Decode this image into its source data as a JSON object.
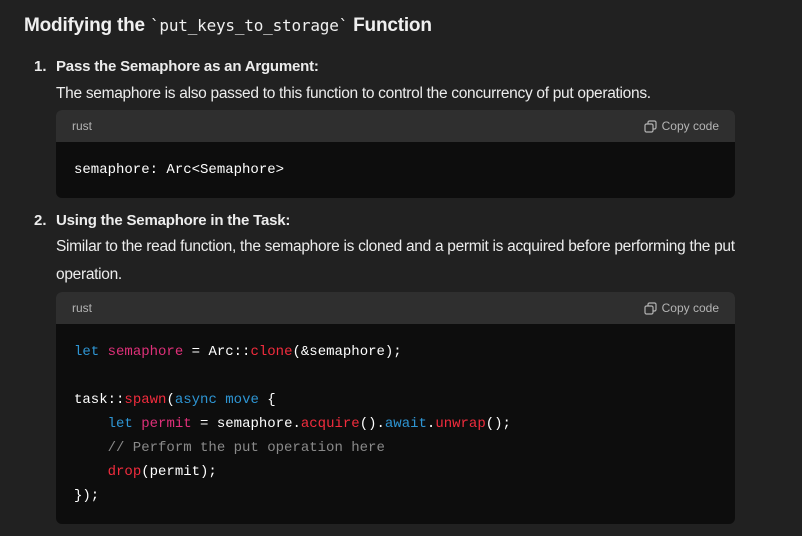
{
  "heading": {
    "pre": "Modifying the ",
    "code": "`put_keys_to_storage`",
    "post": " Function"
  },
  "items": [
    {
      "number": "1.",
      "title": "Pass the Semaphore as an Argument:",
      "text": "The semaphore is also passed to this function to control the concurrency of put operations.",
      "code": {
        "language": "rust",
        "copy_label": "Copy code",
        "lines": [
          [
            [
              "",
              "semaphore: Arc<Semaphore>"
            ]
          ]
        ]
      }
    },
    {
      "number": "2.",
      "title": "Using the Semaphore in the Task:",
      "text": "Similar to the read function, the semaphore is cloned and a permit is acquired before performing the put operation.",
      "code": {
        "language": "rust",
        "copy_label": "Copy code",
        "lines": [
          [
            [
              "k",
              "let"
            ],
            [
              "",
              " "
            ],
            [
              "v",
              "semaphore"
            ],
            [
              "",
              " = Arc::"
            ],
            [
              "f",
              "clone"
            ],
            [
              "",
              "(&semaphore);"
            ]
          ],
          [],
          [
            [
              "",
              "task::"
            ],
            [
              "f",
              "spawn"
            ],
            [
              "",
              "("
            ],
            [
              "k",
              "async"
            ],
            [
              "",
              " "
            ],
            [
              "k",
              "move"
            ],
            [
              "",
              " {"
            ]
          ],
          [
            [
              "",
              "    "
            ],
            [
              "k",
              "let"
            ],
            [
              "",
              " "
            ],
            [
              "v",
              "permit"
            ],
            [
              "",
              " = semaphore."
            ],
            [
              "f",
              "acquire"
            ],
            [
              "",
              "()."
            ],
            [
              "k",
              "await"
            ],
            [
              "",
              "."
            ],
            [
              "f",
              "unwrap"
            ],
            [
              "",
              "();"
            ]
          ],
          [
            [
              "c",
              "    // Perform the put operation here"
            ]
          ],
          [
            [
              "",
              "    "
            ],
            [
              "f",
              "drop"
            ],
            [
              "",
              "(permit);"
            ]
          ],
          [
            [
              "",
              "});"
            ]
          ]
        ]
      }
    }
  ],
  "colors": {
    "keyword": "#2e95d3",
    "function": "#f22c3d",
    "variable": "#df3079",
    "comment": "#8a8a8a"
  }
}
